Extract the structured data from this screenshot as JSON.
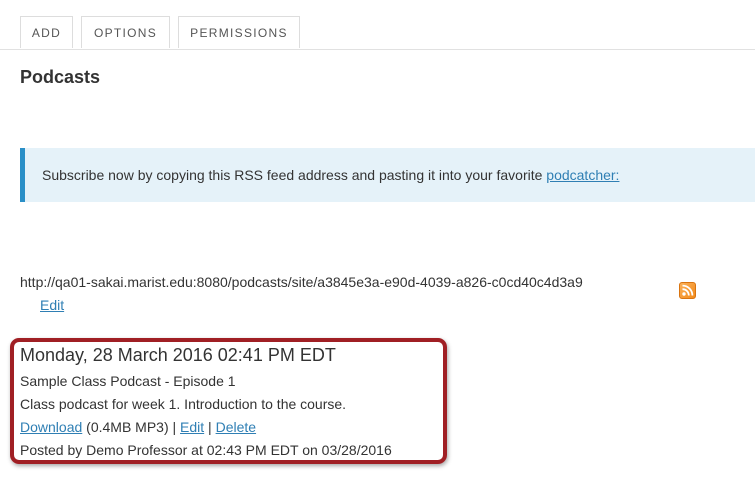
{
  "toolbar": {
    "tabs": [
      {
        "label": "ADD"
      },
      {
        "label": "OPTIONS"
      },
      {
        "label": "PERMISSIONS"
      }
    ]
  },
  "page_title": "Podcasts",
  "info": {
    "text": "Subscribe now by copying this RSS feed address and pasting it into your favorite ",
    "link_label": "podcatcher:"
  },
  "feed": {
    "url": "http://qa01-sakai.marist.edu:8080/podcasts/site/a3845e3a-e90d-4039-a826-c0cd40c4d3a9",
    "edit_label": "Edit",
    "icon": "rss-icon"
  },
  "podcast": {
    "date": "Monday, 28 March 2016 02:41 PM EDT",
    "title": "Sample Class Podcast - Episode 1",
    "description": "Class podcast for week 1. Introduction to the course.",
    "download_label": "Download",
    "file_info": " (0.4MB MP3) | ",
    "edit_label": "Edit",
    "separator": " | ",
    "delete_label": "Delete",
    "posted_by": "Posted by Demo Professor at 02:43 PM EDT on 03/28/2016"
  },
  "colors": {
    "link": "#2f7fb4",
    "info_bg": "#e5f2f9",
    "info_border": "#2a8fc7",
    "highlight": "#a01f24"
  }
}
